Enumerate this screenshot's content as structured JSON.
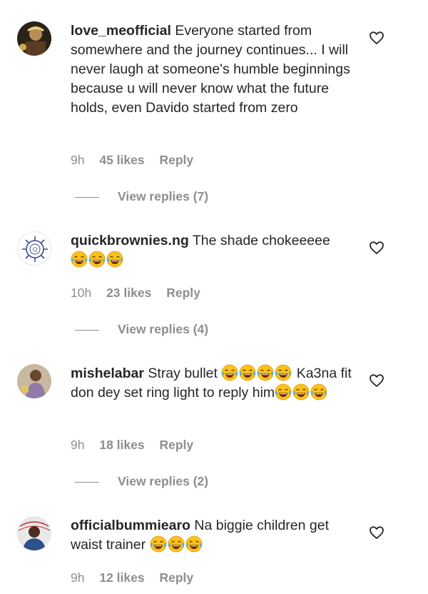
{
  "comments": [
    {
      "username": "love_meofficial",
      "text": "Everyone started from somewhere and the journey continues... I will never laugh at someone's humble beginnings because u will never know what the future holds, even Davido started from zero",
      "time": "9h",
      "likes": "45 likes",
      "reply": "Reply",
      "view_replies": "View replies (7)"
    },
    {
      "username": "quickbrownies.ng",
      "text": "The shade chokeeeee",
      "time": "10h",
      "likes": "23 likes",
      "reply": "Reply",
      "view_replies": "View replies (4)"
    },
    {
      "username": "mishelabar",
      "text_a": "Stray bullet",
      "text_b": "Ka3na fit don dey set ring light to reply him",
      "time": "9h",
      "likes": "18 likes",
      "reply": "Reply",
      "view_replies": "View replies (2)"
    },
    {
      "username": "officialbummiearo",
      "text": "Na biggie children get waist trainer",
      "time": "9h",
      "likes": "12 likes",
      "reply": "Reply"
    }
  ],
  "icons": {
    "like": "heart-outline-icon",
    "emoji": "face-with-tears-of-joy-emoji"
  }
}
